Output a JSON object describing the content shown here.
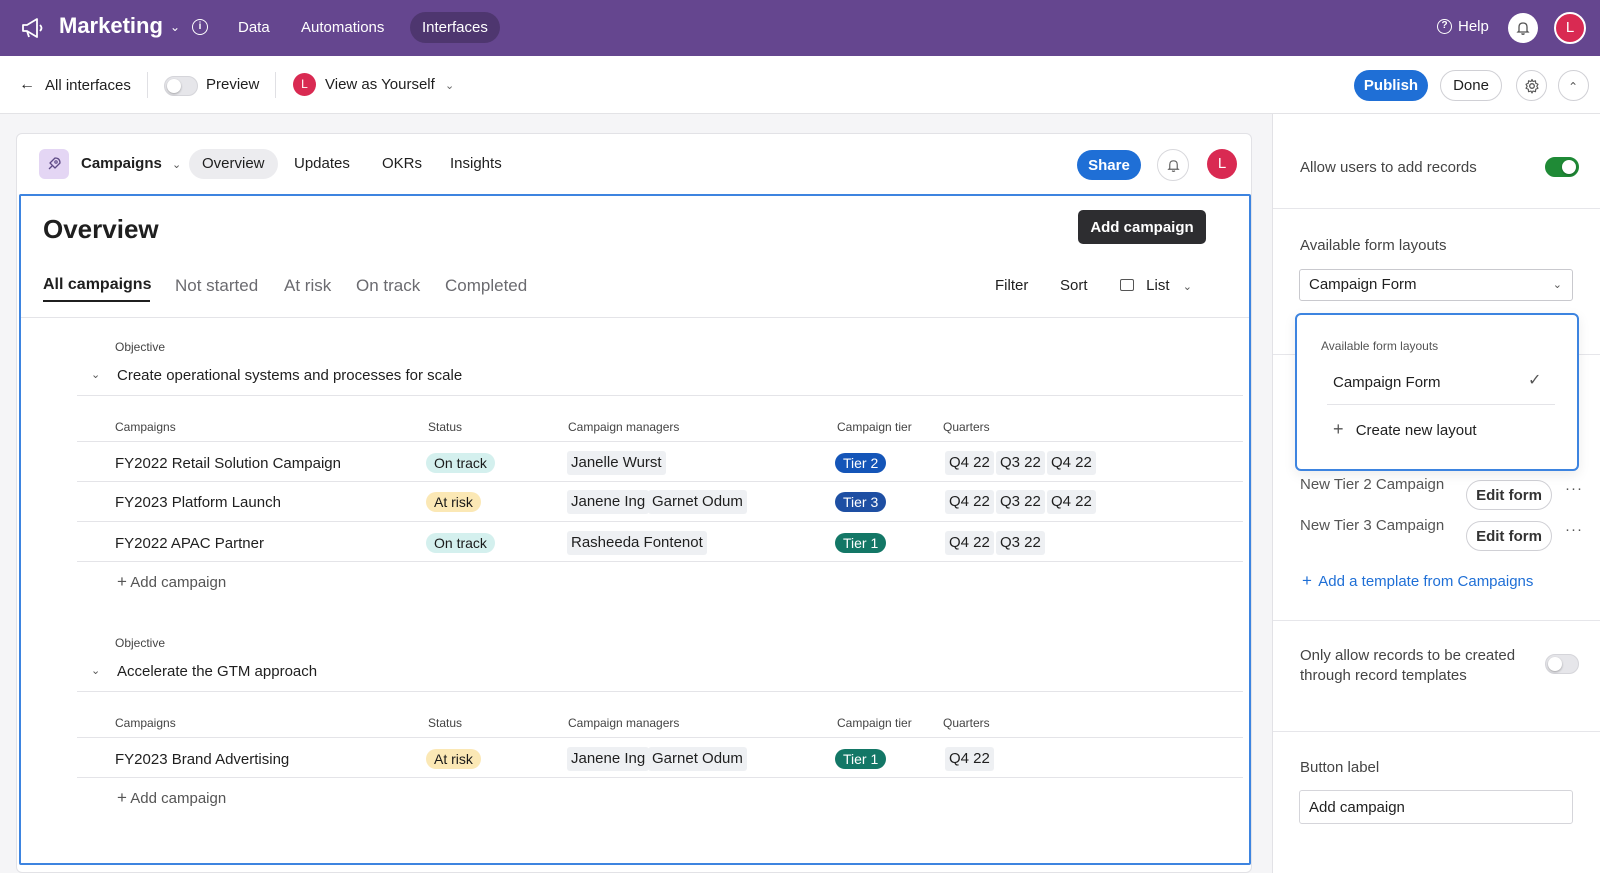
{
  "topbar": {
    "app_title": "Marketing",
    "nav": [
      "Data",
      "Automations",
      "Interfaces"
    ],
    "help_label": "Help",
    "avatar_initial": "L",
    "bg_color": "#65468f"
  },
  "subbar": {
    "back_label": "All interfaces",
    "preview_label": "Preview",
    "view_as_label": "View as Yourself",
    "avatar_initial": "L",
    "publish_label": "Publish",
    "done_label": "Done"
  },
  "card": {
    "project_name": "Campaigns",
    "tabs": [
      "Overview",
      "Updates",
      "OKRs",
      "Insights"
    ],
    "share_label": "Share",
    "avatar_initial": "L"
  },
  "overview": {
    "title": "Overview",
    "add_campaign_label": "Add campaign",
    "sub_tabs": [
      "All campaigns",
      "Not started",
      "At risk",
      "On track",
      "Completed"
    ],
    "filter_label": "Filter",
    "sort_label": "Sort",
    "view_label": "List",
    "objective_label": "Objective",
    "columns": [
      "Campaigns",
      "Status",
      "Campaign managers",
      "Campaign tier",
      "Quarters"
    ],
    "add_row_label": "Add campaign",
    "objectives": [
      {
        "title": "Create operational systems and processes for scale",
        "rows": [
          {
            "name": "FY2022 Retail Solution Campaign",
            "status": "On track",
            "managers": [
              "Janelle Wurst"
            ],
            "tier": "Tier 2",
            "quarters": [
              "Q4 22",
              "Q3 22",
              "Q4 22"
            ]
          },
          {
            "name": "FY2023 Platform Launch",
            "status": "At risk",
            "managers": [
              "Janene Ing",
              "Garnet Odum"
            ],
            "tier": "Tier 3",
            "quarters": [
              "Q4 22",
              "Q3 22",
              "Q4 22"
            ]
          },
          {
            "name": "FY2022 APAC Partner",
            "status": "On track",
            "managers": [
              "Rasheeda Fontenot"
            ],
            "tier": "Tier 1",
            "quarters": [
              "Q4 22",
              "Q3 22"
            ]
          }
        ]
      },
      {
        "title": "Accelerate the GTM approach",
        "rows": [
          {
            "name": "FY2023 Brand Advertising",
            "status": "At risk",
            "managers": [
              "Janene Ing",
              "Garnet Odum"
            ],
            "tier": "Tier 1",
            "quarters": [
              "Q4 22"
            ]
          }
        ]
      }
    ]
  },
  "panel": {
    "allow_add_label": "Allow users to add records",
    "layouts_label": "Available form layouts",
    "selected_layout": "Campaign Form",
    "dropdown": {
      "header": "Available form layouts",
      "item": "Campaign Form",
      "create_label": "Create new layout"
    },
    "templates": [
      {
        "name": "New Tier 2 Campaign",
        "edit_label": "Edit form"
      },
      {
        "name": "New Tier 3 Campaign",
        "edit_label": "Edit form"
      }
    ],
    "add_template_label": "Add a template from Campaigns",
    "only_templates_label_1": "Only allow records to be created",
    "only_templates_label_2": "through record templates",
    "button_label_title": "Button label",
    "button_label_value": "Add campaign"
  }
}
